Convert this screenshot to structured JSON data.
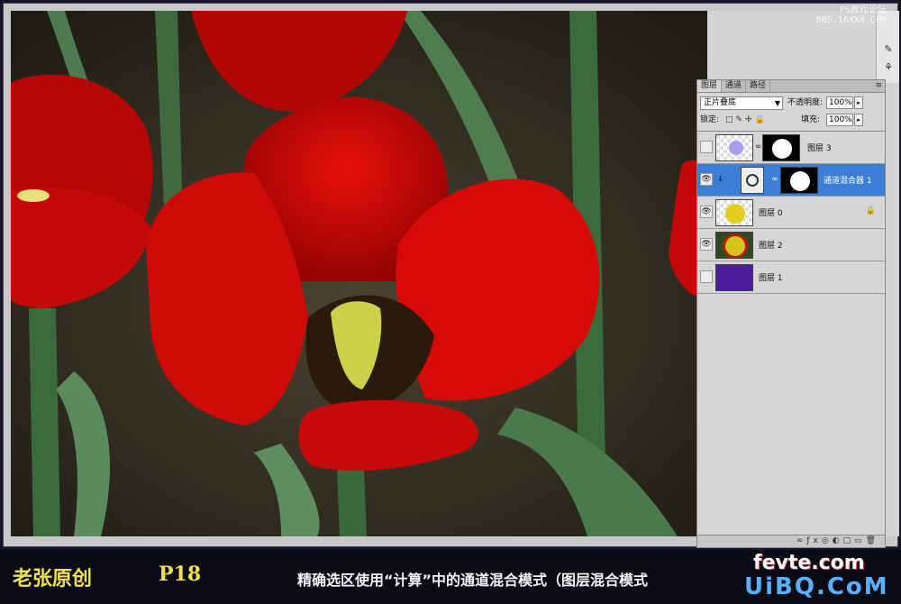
{
  "watermark": {
    "line1": "PS教程论坛",
    "line2": "BBS.16XX8.COM"
  },
  "panel": {
    "tabs": [
      "图层",
      "通道",
      "路径"
    ],
    "menu_icon": "panel-menu-icon",
    "blend_mode": "正片叠底",
    "opacity_label": "不透明度:",
    "opacity_value": "100%",
    "lock_label": "锁定:",
    "fill_label": "填充:",
    "fill_value": "100%",
    "layers": [
      {
        "name": "图层 3",
        "visible": false,
        "selected": false,
        "has_mask": true
      },
      {
        "name": "通道混合器 1",
        "visible": true,
        "selected": true,
        "has_mask": true
      },
      {
        "name": "图层 0",
        "visible": true,
        "selected": false,
        "locked": true
      },
      {
        "name": "图层 2",
        "visible": true,
        "selected": false
      },
      {
        "name": "图层 1",
        "visible": false,
        "selected": false
      }
    ]
  },
  "caption": {
    "author": "老张原创",
    "page": "P18",
    "text": "精确选区使用“计算”中的通道混合模式（图层混合模式",
    "brand_line1": "fevte.com",
    "brand_line2": "UiBQ.CoM"
  },
  "colors": {
    "tulip_red": "#d10a0a",
    "selected_row": "#3a7fd4",
    "caption_yellow": "#f2e24a"
  }
}
